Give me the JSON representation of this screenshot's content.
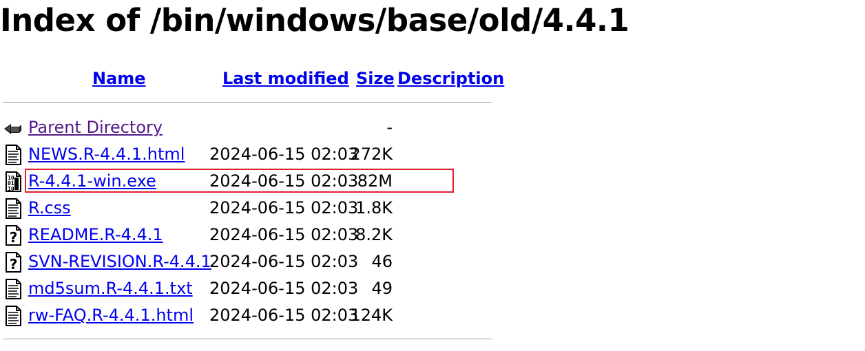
{
  "page": {
    "title": "Index of /bin/windows/base/old/4.4.1"
  },
  "columns": {
    "name": "Name",
    "last_modified": "Last modified",
    "size": "Size",
    "description": "Description"
  },
  "rows": [
    {
      "name": "Parent Directory",
      "date": "",
      "size": "-",
      "icon": "back-icon",
      "visited": true
    },
    {
      "name": "NEWS.R-4.4.1.html",
      "date": "2024-06-15 02:03",
      "size": "272K",
      "icon": "text-file-icon"
    },
    {
      "name": "R-4.4.1-win.exe",
      "date": "2024-06-15 02:03",
      "size": "82M",
      "icon": "binary-file-icon",
      "highlighted": true
    },
    {
      "name": "R.css",
      "date": "2024-06-15 02:03",
      "size": "1.8K",
      "icon": "text-file-icon"
    },
    {
      "name": "README.R-4.4.1",
      "date": "2024-06-15 02:03",
      "size": "8.2K",
      "icon": "unknown-file-icon"
    },
    {
      "name": "SVN-REVISION.R-4.4.1",
      "date": "2024-06-15 02:03",
      "size": "46",
      "icon": "unknown-file-icon"
    },
    {
      "name": "md5sum.R-4.4.1.txt",
      "date": "2024-06-15 02:03",
      "size": "49",
      "icon": "text-file-icon"
    },
    {
      "name": "rw-FAQ.R-4.4.1.html",
      "date": "2024-06-15 02:03",
      "size": "124K",
      "icon": "text-file-icon"
    }
  ],
  "colors": {
    "link": "#0000ee",
    "visited": "#551a8b",
    "highlight_border": "#e0202a"
  }
}
